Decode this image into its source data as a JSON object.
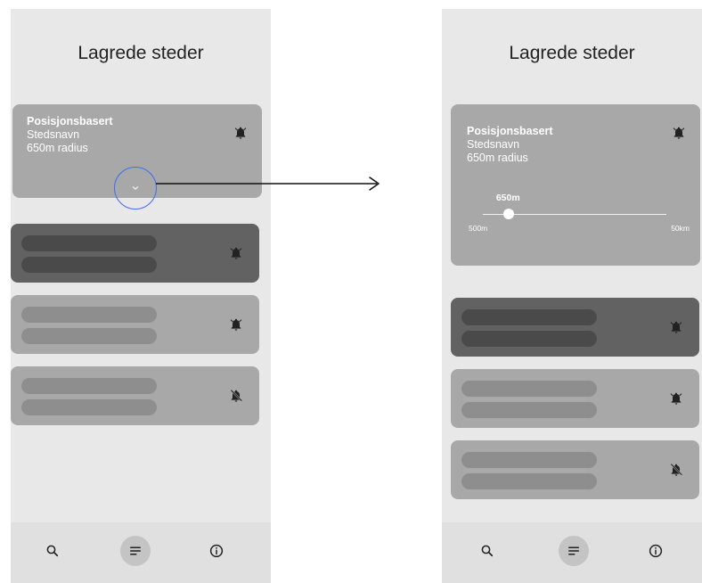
{
  "left_screen": {
    "title": "Lagrede steder",
    "expanded_card": {
      "name": "Posisjonsbasert",
      "place": "Stedsnavn",
      "radius": "650m radius",
      "icon": "bell-icon",
      "expand_icon": "chevron-down-icon"
    },
    "cards": [
      {
        "style": "dark",
        "icon": "bell-icon"
      },
      {
        "style": "light",
        "icon": "bell-icon"
      },
      {
        "style": "light",
        "icon": "bell-off-icon"
      }
    ],
    "nav": [
      "search-icon",
      "list-icon",
      "info-icon"
    ],
    "nav_active": "list-icon"
  },
  "right_screen": {
    "title": "Lagrede steder",
    "expanded_card": {
      "name": "Posisjonsbasert",
      "place": "Stedsnavn",
      "radius": "650m radius",
      "icon": "bell-icon",
      "slider": {
        "value_label": "650m",
        "min_label": "500m",
        "max_label": "50km",
        "position_fraction": 0.14
      }
    },
    "cards": [
      {
        "style": "dark",
        "icon": "bell-icon"
      },
      {
        "style": "light",
        "icon": "bell-icon"
      },
      {
        "style": "light",
        "icon": "bell-off-icon"
      }
    ],
    "nav": [
      "search-icon",
      "list-icon",
      "info-icon"
    ],
    "nav_active": "list-icon"
  },
  "colors": {
    "screen_bg": "#e8e8e8",
    "card_light": "#a8a8a8",
    "card_dark": "#626262",
    "highlight": "#3d6cf0"
  }
}
